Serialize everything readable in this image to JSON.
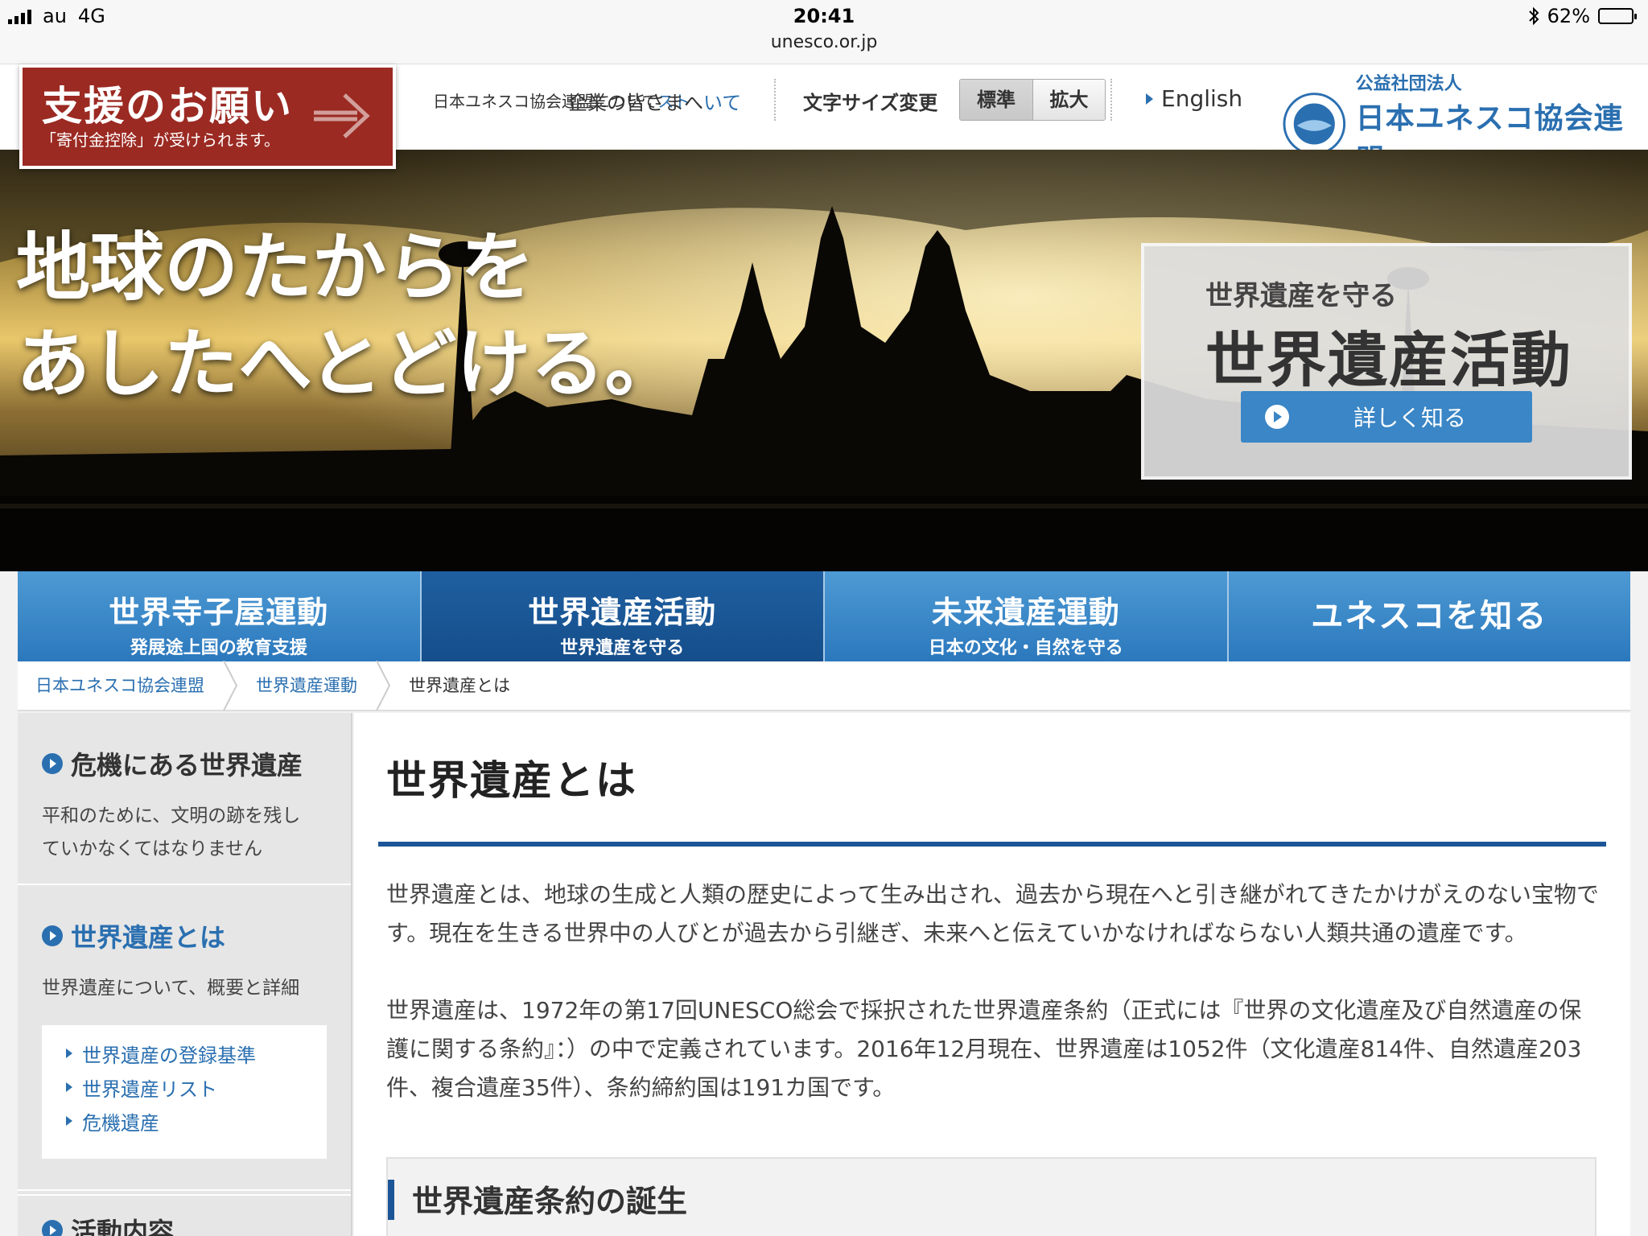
{
  "status_bar": {
    "carrier": "au",
    "network": "4G",
    "time": "20:41",
    "url": "unesco.or.jp",
    "battery": "62%",
    "battery_level": 0.62
  },
  "header": {
    "donate": {
      "title": "支援のお願い",
      "subtitle": "「寄付金控除」が受けられます。"
    },
    "about_link": "日本ユネスコ協会連盟について",
    "about_link_tail": "スト",
    "corporate_link": "企業の皆さまへ",
    "corporate_link_tail": "いて",
    "font_size_label": "文字サイズ変更",
    "font_size_options": [
      "標準",
      "拡大"
    ],
    "font_size_selected": "標準",
    "english_link": "English",
    "logo": {
      "line1": "公益社団法人",
      "line2": "日本ユネスコ協会連盟"
    }
  },
  "hero": {
    "headline_line1": "地球のたからを",
    "headline_line2": "あしたへとどける。",
    "card": {
      "subtitle": "世界遺産を守る",
      "title": "世界遺産活動",
      "button": "詳しく知る"
    }
  },
  "global_nav": [
    {
      "title": "世界寺子屋運動",
      "sub": "発展途上国の教育支援"
    },
    {
      "title": "世界遺産活動",
      "sub": "世界遺産を守る"
    },
    {
      "title": "未来遺産運動",
      "sub": "日本の文化・自然を守る"
    },
    {
      "title": "ユネスコを知る",
      "sub": ""
    }
  ],
  "global_nav_active": "世界遺産活動",
  "breadcrumb": [
    "日本ユネスコ協会連盟",
    "世界遺産運動",
    "世界遺産とは"
  ],
  "sidebar": {
    "sections": [
      {
        "title": "危機にある世界遺産",
        "desc_line1": "平和のために、文明の跡を残し",
        "desc_line2": "ていかなくてはなりません"
      },
      {
        "title": "世界遺産とは",
        "desc_line1": "世界遺産について、概要と詳細",
        "links": [
          "世界遺産の登録基準",
          "世界遺産リスト",
          "危機遺産"
        ]
      },
      {
        "title": "活動内容"
      }
    ]
  },
  "main": {
    "title": "世界遺産とは",
    "para1": "世界遺産とは、地球の生成と人類の歴史によって生み出され、過去から現在へと引き継がれてきたかけがえのない宝物です。現在を生きる世界中の人びとが過去から引継ぎ、未来へと伝えていかなければならない人類共通の遺産です。",
    "para2": "世界遺産は、1972年の第17回UNESCO総会で採択された世界遺産条約（正式には『世界の文化遺産及び自然遺産の保護に関する条約』：）の中で定義されています。2016年12月現在、世界遺産は1052件（文化遺産814件、自然遺産203件、複合遺産35件）、条約締約国は191カ国です。",
    "section_title": "世界遺産条約の誕生"
  },
  "colors": {
    "brand_blue": "#2a6fb0",
    "nav_blue": "#3a86c6",
    "nav_active": "#1c5597",
    "donate_red": "#9b2a22"
  }
}
